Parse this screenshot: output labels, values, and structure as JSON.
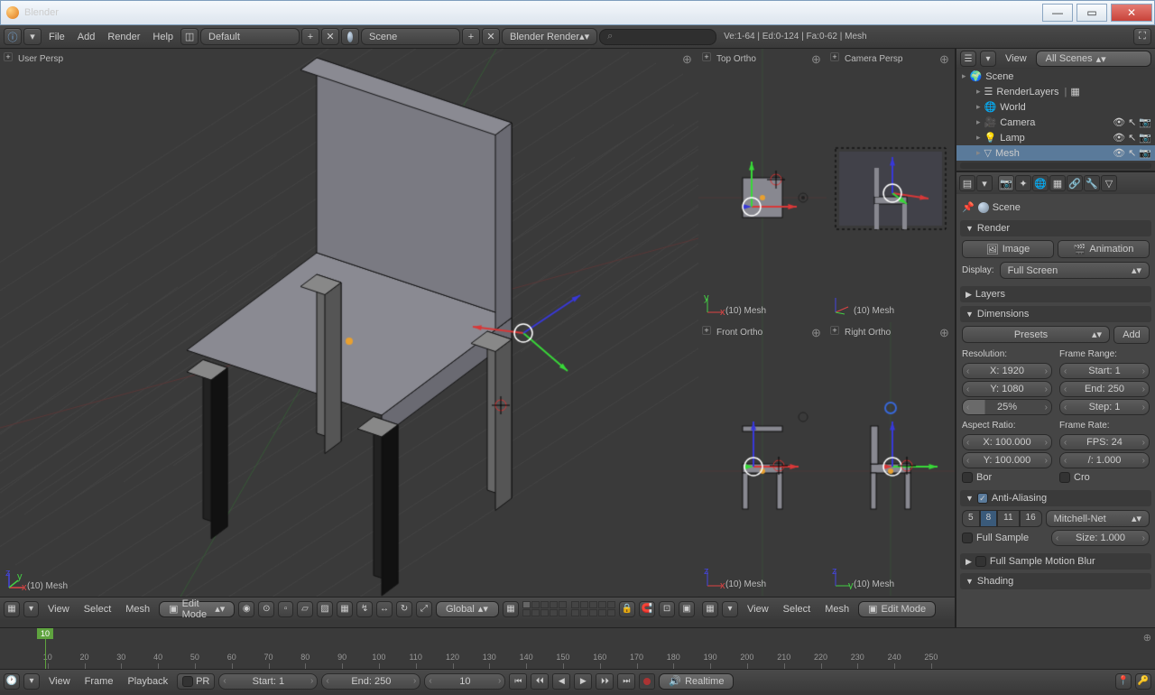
{
  "window": {
    "title": "Blender"
  },
  "header": {
    "menus": [
      "File",
      "Add",
      "Render",
      "Help"
    ],
    "layout": "Default",
    "scene": "Scene",
    "engine": "Blender Render",
    "stats": "Ve:1-64 | Ed:0-124 | Fa:0-62 | Mesh"
  },
  "viewports": {
    "main": {
      "label": "User Persp",
      "object": "(10) Mesh"
    },
    "top": {
      "label": "Top Ortho",
      "object": "(10) Mesh"
    },
    "camera": {
      "label": "Camera Persp",
      "object": "(10) Mesh"
    },
    "front": {
      "label": "Front Ortho",
      "object": "(10) Mesh"
    },
    "right": {
      "label": "Right Ortho",
      "object": "(10) Mesh"
    }
  },
  "vp_toolbar_main": {
    "menus": [
      "View",
      "Select",
      "Mesh"
    ],
    "mode": "Edit Mode",
    "orient": "Global"
  },
  "vp_toolbar_sm": {
    "menus": [
      "View",
      "Select",
      "Mesh"
    ],
    "mode": "Edit Mode"
  },
  "outliner": {
    "view_menu": "View",
    "filter": "All Scenes",
    "items": [
      {
        "name": "Scene",
        "icon": "scene"
      },
      {
        "name": "RenderLayers",
        "icon": "layers",
        "indent": 1,
        "extra": true
      },
      {
        "name": "World",
        "icon": "world",
        "indent": 1
      },
      {
        "name": "Camera",
        "icon": "camera",
        "indent": 1,
        "vis": true
      },
      {
        "name": "Lamp",
        "icon": "lamp",
        "indent": 1,
        "vis": true
      },
      {
        "name": "Mesh",
        "icon": "mesh",
        "indent": 1,
        "sel": true,
        "vis": true
      }
    ]
  },
  "props": {
    "breadcrumb": "Scene",
    "render": {
      "title": "Render",
      "image_btn": "Image",
      "anim_btn": "Animation",
      "display_label": "Display:",
      "display": "Full Screen"
    },
    "layers": {
      "title": "Layers"
    },
    "dimensions": {
      "title": "Dimensions",
      "presets": "Presets",
      "add": "Add",
      "res_label": "Resolution:",
      "res_x": "X: 1920",
      "res_y": "Y: 1080",
      "res_pct": "25%",
      "frame_label": "Frame Range:",
      "frame_start": "Start: 1",
      "frame_end": "End: 250",
      "frame_step": "Step: 1",
      "aspect_label": "Aspect Ratio:",
      "aspect_x": "X: 100.000",
      "aspect_y": "Y: 100.000",
      "rate_label": "Frame Rate:",
      "fps": "FPS: 24",
      "fps_base": "/: 1.000",
      "border": "Bor",
      "crop": "Cro"
    },
    "aa": {
      "title": "Anti-Aliasing",
      "samples": [
        "5",
        "8",
        "11",
        "16"
      ],
      "filter": "Mitchell-Net",
      "full_sample": "Full Sample",
      "size": "Size: 1.000"
    },
    "blur": {
      "title": "Full Sample Motion Blur"
    },
    "shading": {
      "title": "Shading"
    }
  },
  "timeline": {
    "menus": [
      "View",
      "Frame",
      "Playback"
    ],
    "pr": "PR",
    "start": "Start: 1",
    "end": "End: 250",
    "current": "10",
    "sync": "Realtime",
    "ticks": [
      10,
      30,
      50,
      70,
      90,
      110,
      130,
      150,
      170,
      190,
      210,
      230,
      250
    ],
    "all": [
      10,
      20,
      30,
      40,
      50,
      60,
      70,
      80,
      90,
      100,
      110,
      120,
      130,
      140,
      150,
      160,
      170,
      180,
      190,
      200,
      210,
      220,
      230,
      240,
      250
    ]
  }
}
